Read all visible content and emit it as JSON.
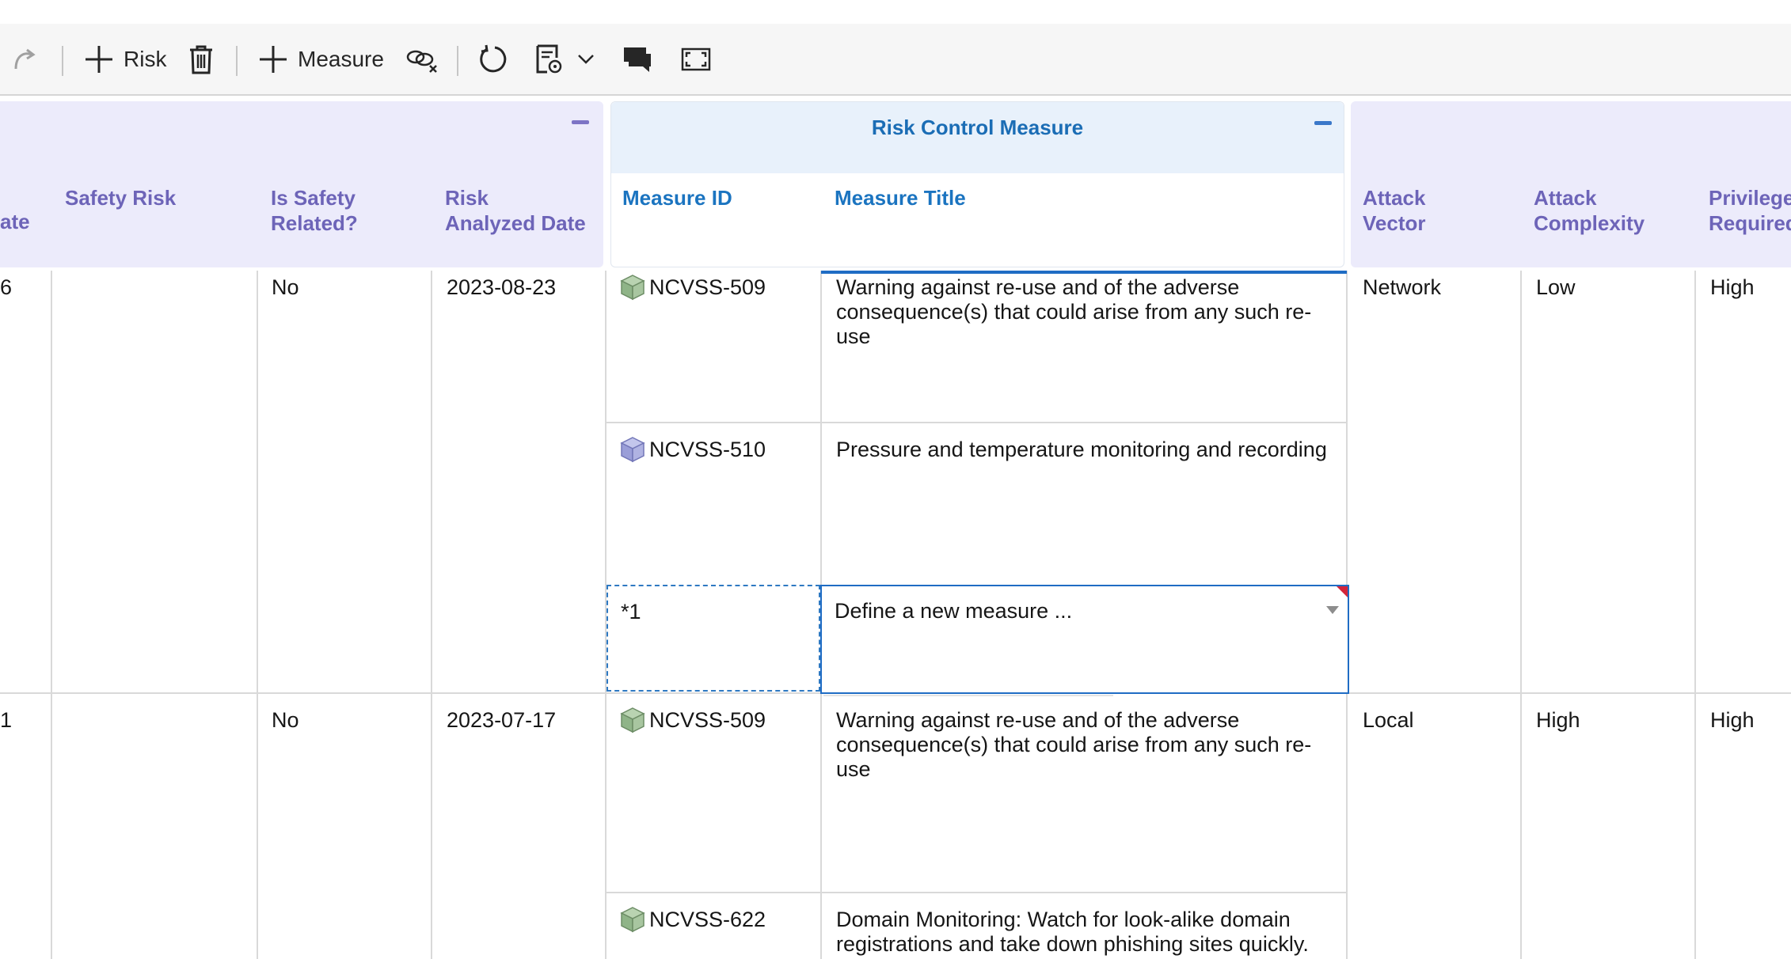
{
  "toolbar": {
    "add_risk_label": "Risk",
    "add_measure_label": "Measure"
  },
  "group_headers": {
    "risk_control_measure": "Risk Control Measure"
  },
  "columns": {
    "date_partial": "ate",
    "safety_risk": "Safety Risk",
    "is_safety_related": [
      "Is Safety",
      "Related?"
    ],
    "risk_analyzed_date": [
      "Risk",
      "Analyzed Date"
    ],
    "measure_id": "Measure ID",
    "measure_title": "Measure Title",
    "attack_vector": [
      "Attack",
      "Vector"
    ],
    "attack_complexity": [
      "Attack",
      "Complexity"
    ],
    "privileges_required": [
      "Privilege",
      "Required"
    ]
  },
  "rows": [
    {
      "partial": "6",
      "safety_risk": "",
      "is_safety_related": "No",
      "risk_analyzed_date": "2023-08-23",
      "attack_vector": "Network",
      "attack_complexity": "Low",
      "privileges_required": "High",
      "measures": [
        {
          "id": "NCVSS-509",
          "icon": "green-cube-icon",
          "title": "Warning against re-use and of the adverse consequence(s) that could arise from any such re-use"
        },
        {
          "id": "NCVSS-510",
          "icon": "blue-cube-icon",
          "title": "Pressure and temperature monitoring and recording"
        },
        {
          "id": "*1",
          "title": "Define a new measure ..."
        }
      ]
    },
    {
      "partial": "1",
      "safety_risk": "",
      "is_safety_related": "No",
      "risk_analyzed_date": "2023-07-17",
      "attack_vector": "Local",
      "attack_complexity": "High",
      "privileges_required": "High",
      "measures": [
        {
          "id": "NCVSS-509",
          "icon": "green-cube-icon",
          "title": "Warning against re-use and of the adverse consequence(s) that could arise from any such re-use"
        },
        {
          "id": "NCVSS-622",
          "icon": "green-cube-icon",
          "title": "Domain Monitoring: Watch for look-alike domain registrations and take down phishing sites quickly."
        }
      ]
    }
  ],
  "colors": {
    "risk_header_bg": "#ecebfb",
    "risk_header_text": "#6d64b8",
    "measure_header_text": "#1b74c0",
    "accent": "#1f6cc4"
  }
}
